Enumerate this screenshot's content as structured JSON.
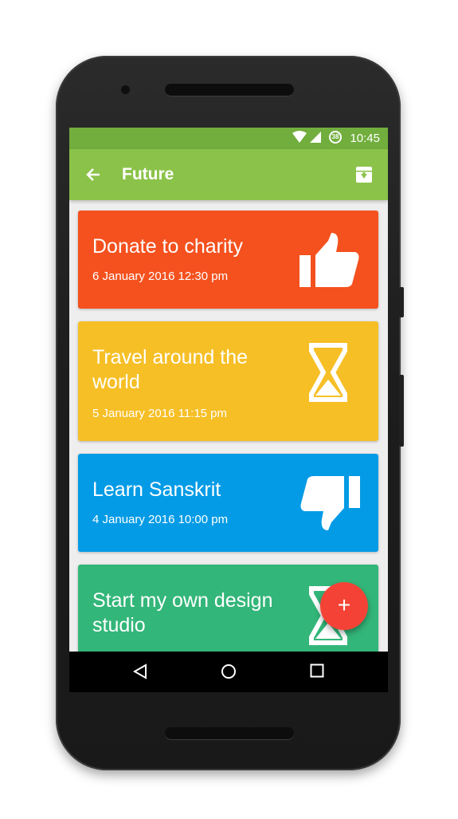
{
  "status_bar": {
    "time": "10:45",
    "badge": "38"
  },
  "app_bar": {
    "title": "Future",
    "back_icon": "arrow-back-icon",
    "action_icon": "archive-download-icon"
  },
  "cards": [
    {
      "title": "Donate to charity",
      "date": "6 January 2016  12:30 pm",
      "color": "#f4511e",
      "icon": "thumbs-up-icon"
    },
    {
      "title": "Travel around the world",
      "date": "5 January 2016  11:15 pm",
      "color": "#f6bf26",
      "icon": "hourglass-icon"
    },
    {
      "title": "Learn Sanskrit",
      "date": "4 January 2016  10:00 pm",
      "color": "#039be5",
      "icon": "thumbs-down-icon"
    },
    {
      "title": "Start my own design studio",
      "date": "",
      "color": "#33b679",
      "icon": "hourglass-icon"
    }
  ],
  "fab": {
    "label": "+"
  },
  "nav": {
    "back": "nav-back-icon",
    "home": "nav-home-icon",
    "recents": "nav-recents-icon"
  }
}
